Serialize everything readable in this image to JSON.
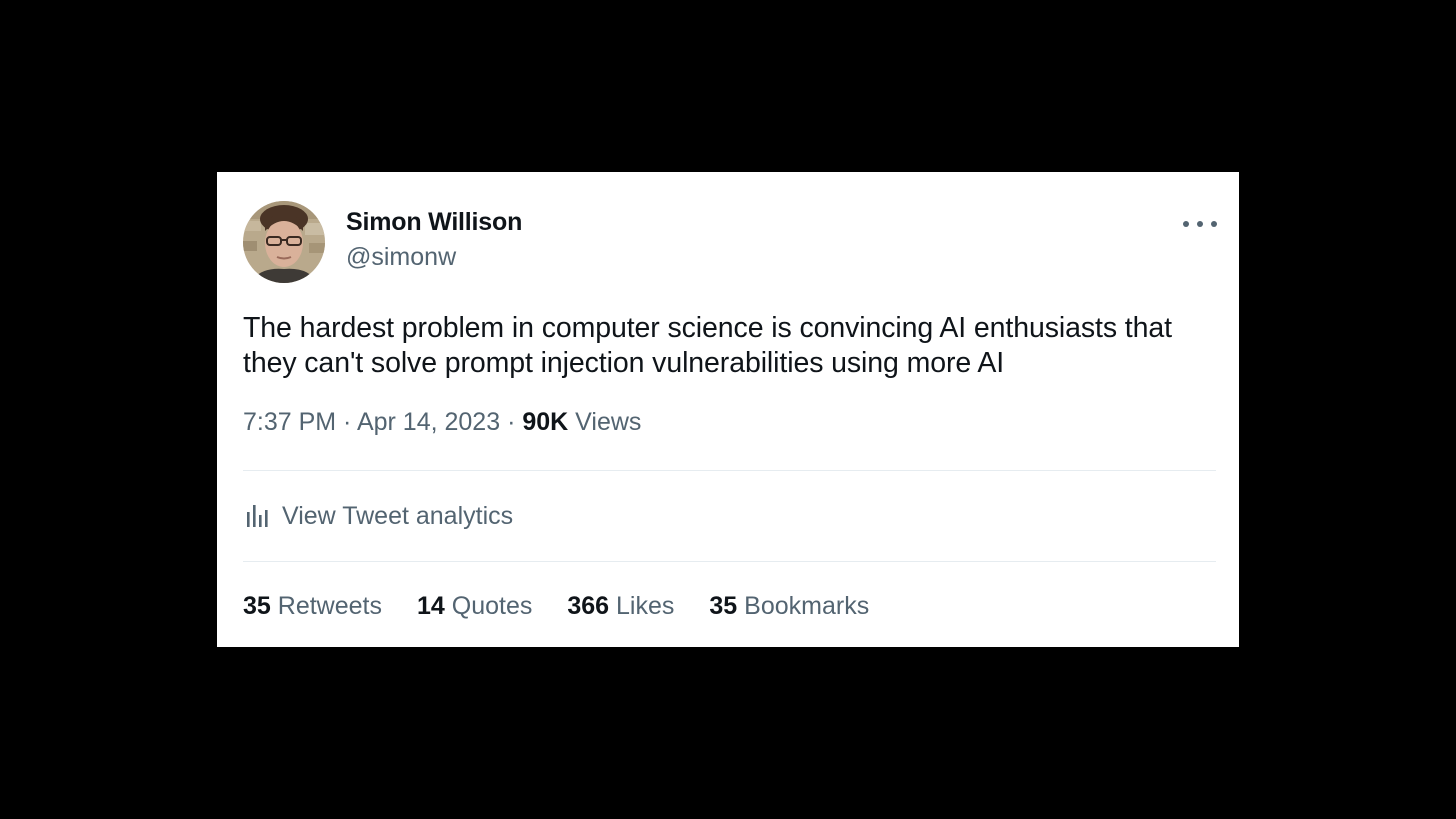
{
  "author": {
    "display_name": "Simon Willison",
    "handle": "@simonw",
    "avatar": "profile-photo"
  },
  "tweet": {
    "text": "The hardest problem in computer science is convincing AI enthusiasts that they can't solve prompt injection vulnerabilities using more AI",
    "time": "7:37 PM",
    "separator": " · ",
    "date": "Apr 14, 2023",
    "views_count": "90K",
    "views_label": "Views"
  },
  "analytics": {
    "label": "View Tweet analytics",
    "icon": "bar-chart-icon"
  },
  "stats": [
    {
      "count": "35",
      "label": "Retweets"
    },
    {
      "count": "14",
      "label": "Quotes"
    },
    {
      "count": "366",
      "label": "Likes"
    },
    {
      "count": "35",
      "label": "Bookmarks"
    }
  ],
  "more_icon": "more-horizontal-icon",
  "colors": {
    "primary_text": "#0f1419",
    "secondary_text": "#536471",
    "divider": "#e6ecf0",
    "background": "#ffffff",
    "page_background": "#000000"
  }
}
